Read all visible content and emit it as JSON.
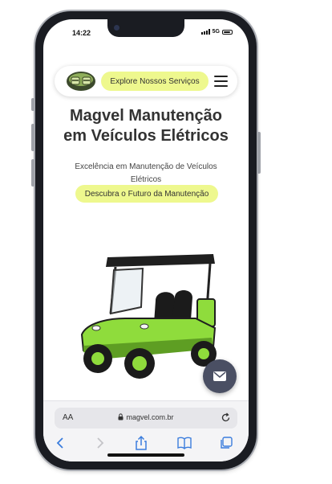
{
  "status_bar": {
    "time": "14:22",
    "network": "5G"
  },
  "navbar": {
    "services_label": "Explore Nossos Serviços"
  },
  "hero": {
    "title_line1": "Magvel Manutenção",
    "title_line2": "em Veículos Elétricos",
    "subtitle": "Excelência em Manutenção de Veículos Elétricos",
    "cta_label": "Descubra o Futuro da Manutenção"
  },
  "browser": {
    "text_size_label": "AA",
    "url": "magvel.com.br"
  },
  "icons": {
    "logo": "magvel-logo",
    "menu": "hamburger-menu-icon",
    "fab": "mail-icon",
    "lock": "lock-icon",
    "reload": "reload-icon",
    "back": "chevron-left-icon",
    "forward": "chevron-right-icon",
    "share": "share-icon",
    "bookmarks": "book-icon",
    "tabs": "tabs-icon"
  },
  "colors": {
    "accent": "#eef88e",
    "cart_green": "#8fdc3c",
    "fab": "#4a4f63"
  }
}
